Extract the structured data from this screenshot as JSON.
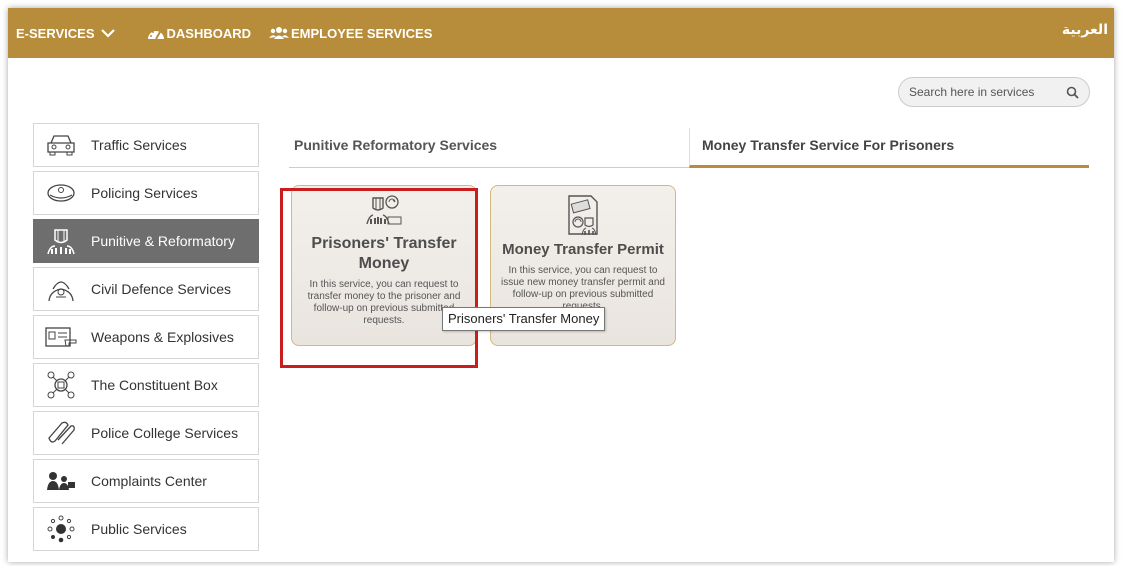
{
  "topbar": {
    "eservices_label": "E-SERVICES",
    "dashboard_label": "DASHBOARD",
    "employee_services_label": "EMPLOYEE SERVICES",
    "language_label": "العربية",
    "bar_color": "#b78d3c"
  },
  "search": {
    "placeholder": "Search here in services"
  },
  "sidebar": {
    "items": [
      {
        "label": "Traffic Services",
        "icon": "car-icon"
      },
      {
        "label": "Policing Services",
        "icon": "police-cap-icon"
      },
      {
        "label": "Punitive & Reformatory",
        "icon": "prisoner-icon",
        "active": true
      },
      {
        "label": "Civil Defence Services",
        "icon": "firefighter-icon"
      },
      {
        "label": "Weapons & Explosives",
        "icon": "id-card-icon"
      },
      {
        "label": "The Constituent Box",
        "icon": "network-box-icon"
      },
      {
        "label": "Police College Services",
        "icon": "diploma-icon"
      },
      {
        "label": "Complaints Center",
        "icon": "complaints-icon"
      },
      {
        "label": "Public Services",
        "icon": "dots-cluster-icon"
      }
    ]
  },
  "tabs": [
    {
      "label": "Punitive Reformatory Services"
    },
    {
      "label": "Money Transfer Service For Prisoners",
      "active": true
    }
  ],
  "cards": [
    {
      "title": "Prisoners' Transfer Money",
      "description": "In this service, you can request to transfer money to the prisoner and follow-up on previous submitted requests.",
      "icon": "prisoner-money-icon"
    },
    {
      "title": "Money Transfer Permit",
      "description": "In this service, you can request to issue new money transfer permit and follow-up on previous submitted requests.",
      "icon": "money-permit-icon"
    }
  ],
  "tooltip": "Prisoners' Transfer Money",
  "highlight_color": "#c81e1e"
}
